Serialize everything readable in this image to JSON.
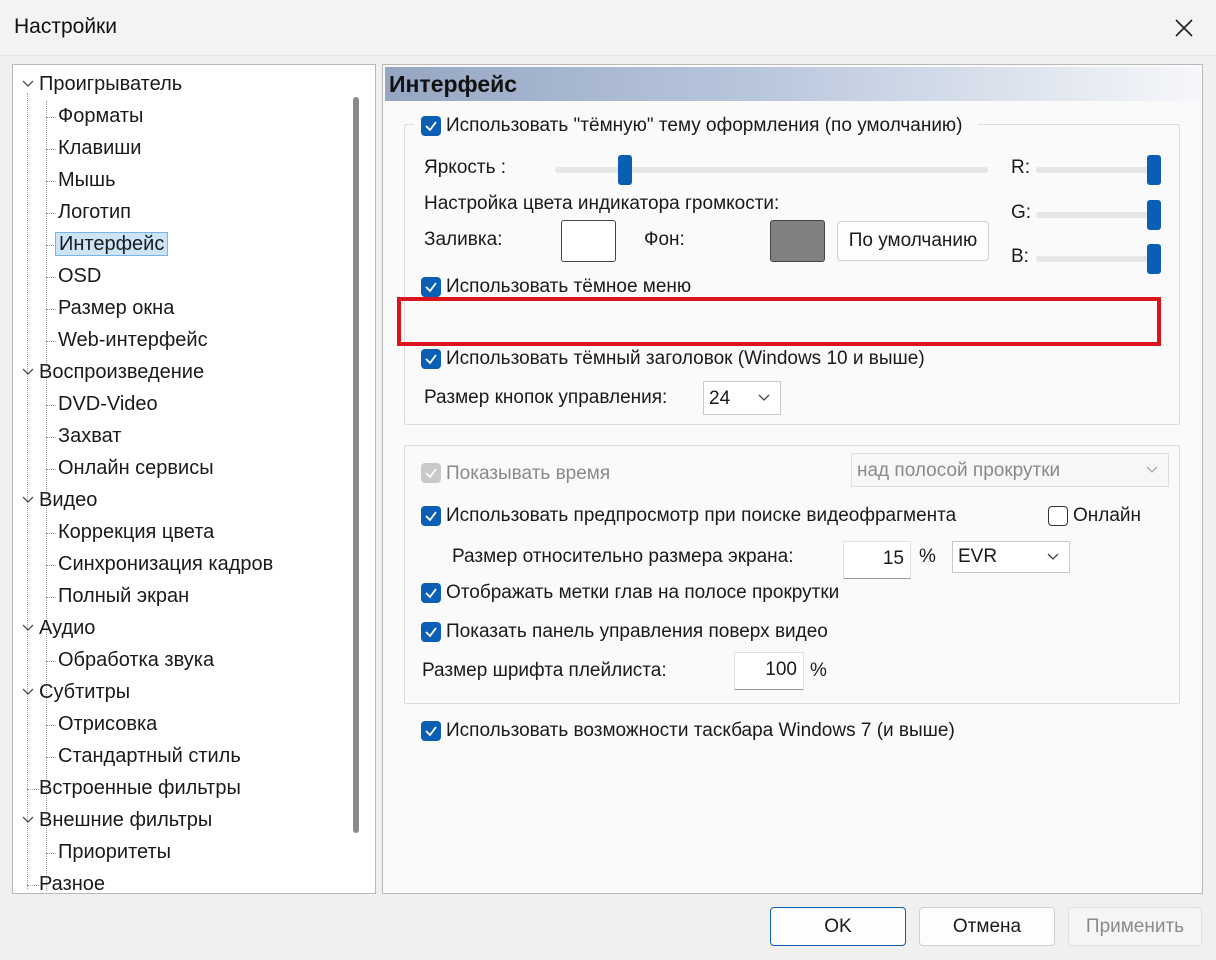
{
  "window": {
    "title": "Настройки"
  },
  "tree": {
    "items": [
      {
        "label": "Проигрыватель"
      },
      {
        "label": "Форматы"
      },
      {
        "label": "Клавиши"
      },
      {
        "label": "Мышь"
      },
      {
        "label": "Логотип"
      },
      {
        "label": "Интерфейс"
      },
      {
        "label": "OSD"
      },
      {
        "label": "Размер окна"
      },
      {
        "label": "Web-интерфейс"
      },
      {
        "label": "Воспроизведение"
      },
      {
        "label": "DVD-Video"
      },
      {
        "label": "Захват"
      },
      {
        "label": "Онлайн сервисы"
      },
      {
        "label": "Видео"
      },
      {
        "label": "Коррекция цвета"
      },
      {
        "label": "Синхронизация кадров"
      },
      {
        "label": "Полный экран"
      },
      {
        "label": "Аудио"
      },
      {
        "label": "Обработка звука"
      },
      {
        "label": "Субтитры"
      },
      {
        "label": "Отрисовка"
      },
      {
        "label": "Стандартный стиль"
      },
      {
        "label": "Встроенные фильтры"
      },
      {
        "label": "Внешние фильтры"
      },
      {
        "label": "Приоритеты"
      },
      {
        "label": "Разное"
      }
    ],
    "selected": "Интерфейс"
  },
  "page": {
    "header": "Интерфейс",
    "theme": {
      "dark_theme_label": "Использовать \"тёмную\" тему оформления (по умолчанию)",
      "dark_theme_checked": true,
      "brightness_label": "Яркость :",
      "brightness_value": 0.1,
      "r_label": "R:",
      "g_label": "G:",
      "b_label": "B:",
      "r_value": 1.0,
      "g_value": 1.0,
      "b_value": 1.0,
      "volume_color_label": "Настройка цвета индикатора громкости:",
      "fill_label": "Заливка:",
      "fill_color": "#ffffff",
      "bg_label": "Фон:",
      "bg_color": "#808080",
      "default_button": "По умолчанию",
      "dark_menu_label": "Использовать тёмное меню",
      "dark_menu_checked": true,
      "dark_title_label": "Использовать тёмный заголовок (Windows 10 и выше)",
      "dark_title_checked": true,
      "button_size_label": "Размер кнопок управления:",
      "button_size_value": "24"
    },
    "seek": {
      "show_time_label": "Показывать время",
      "show_time_position": "над полосой прокрутки",
      "preview_label": "Использовать предпросмотр при поиске видеофрагмента",
      "online_label": "Онлайн",
      "relative_size_label": "Размер относительно размера экрана:",
      "relative_size_value": "15",
      "percent": "%",
      "renderer": "EVR",
      "chapter_marks_label": "Отображать метки глав на полосе прокрутки",
      "overlay_panel_label": "Показать панель управления поверх видео",
      "playlist_font_label": "Размер шрифта плейлиста:",
      "playlist_font_value": "100",
      "playlist_percent": "%"
    },
    "taskbar_label": "Использовать возможности таскбара Windows 7 (и выше)"
  },
  "footer": {
    "ok": "OK",
    "cancel": "Отмена",
    "apply": "Применить"
  },
  "colors": {
    "accent": "#0a5fb4",
    "highlight": "#d9141c"
  }
}
